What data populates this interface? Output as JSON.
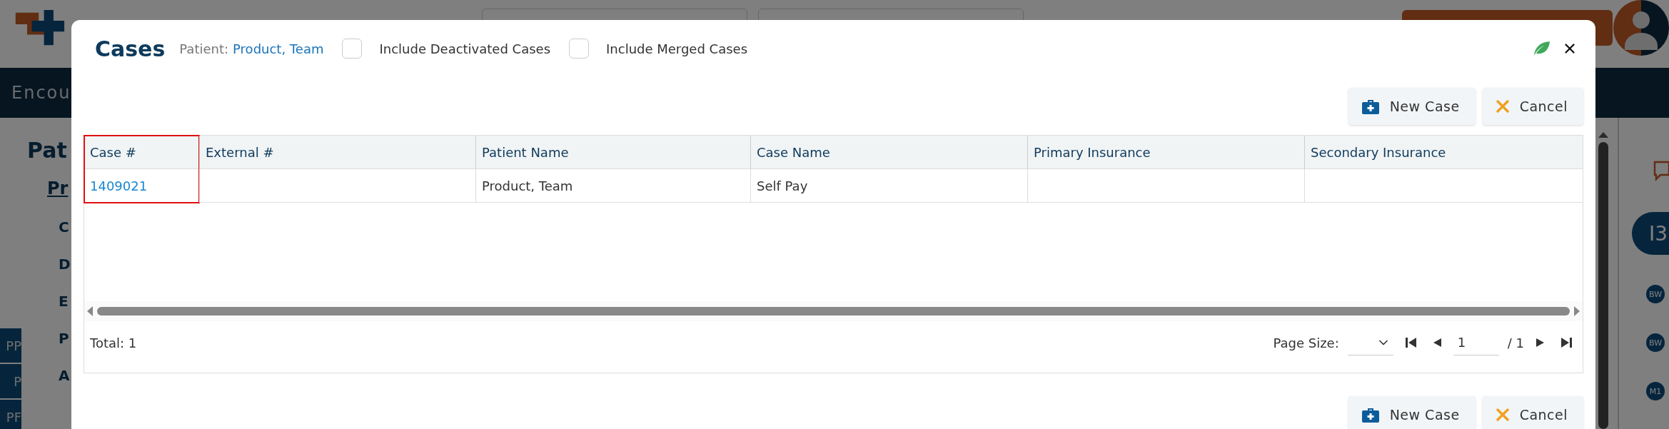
{
  "app_background": {
    "nav_label": "Encou",
    "page_title": "Pat",
    "section_link": "Pr",
    "field_labels": [
      "C",
      "D",
      "E",
      "P",
      "A"
    ],
    "side_tabs": [
      "PP",
      "P",
      "PF"
    ],
    "rail_badge": "I3",
    "rail_avatars": [
      "BW",
      "BW",
      "M1"
    ]
  },
  "dialog": {
    "title": "Cases",
    "patient_label": "Patient:",
    "patient_name": "Product, Team",
    "options": [
      {
        "label": "Include Deactivated Cases",
        "checked": false
      },
      {
        "label": "Include Merged Cases",
        "checked": false
      }
    ]
  },
  "top_buttons": [
    {
      "kind": "new",
      "label": "New Case"
    },
    {
      "kind": "cancel",
      "label": "Cancel"
    }
  ],
  "table": {
    "columns": [
      {
        "label": "Case #",
        "highlighted": true
      },
      {
        "label": "External #",
        "highlighted": false
      },
      {
        "label": "Patient Name",
        "highlighted": false
      },
      {
        "label": "Case Name",
        "highlighted": false
      },
      {
        "label": "Primary Insurance",
        "highlighted": false
      },
      {
        "label": "Secondary Insurance",
        "highlighted": false
      }
    ],
    "rows": [
      {
        "case_number": "1409021",
        "patient_name": "Product, Team",
        "case_name": "Self Pay"
      }
    ]
  },
  "footer": {
    "total": "Total: 1",
    "page_size_label": "Page Size:",
    "page": "1",
    "page_count": "/ 1"
  },
  "bottom_buttons": [
    {
      "kind": "new",
      "label": "New Case"
    },
    {
      "kind": "cancel",
      "label": "Cancel"
    }
  ]
}
